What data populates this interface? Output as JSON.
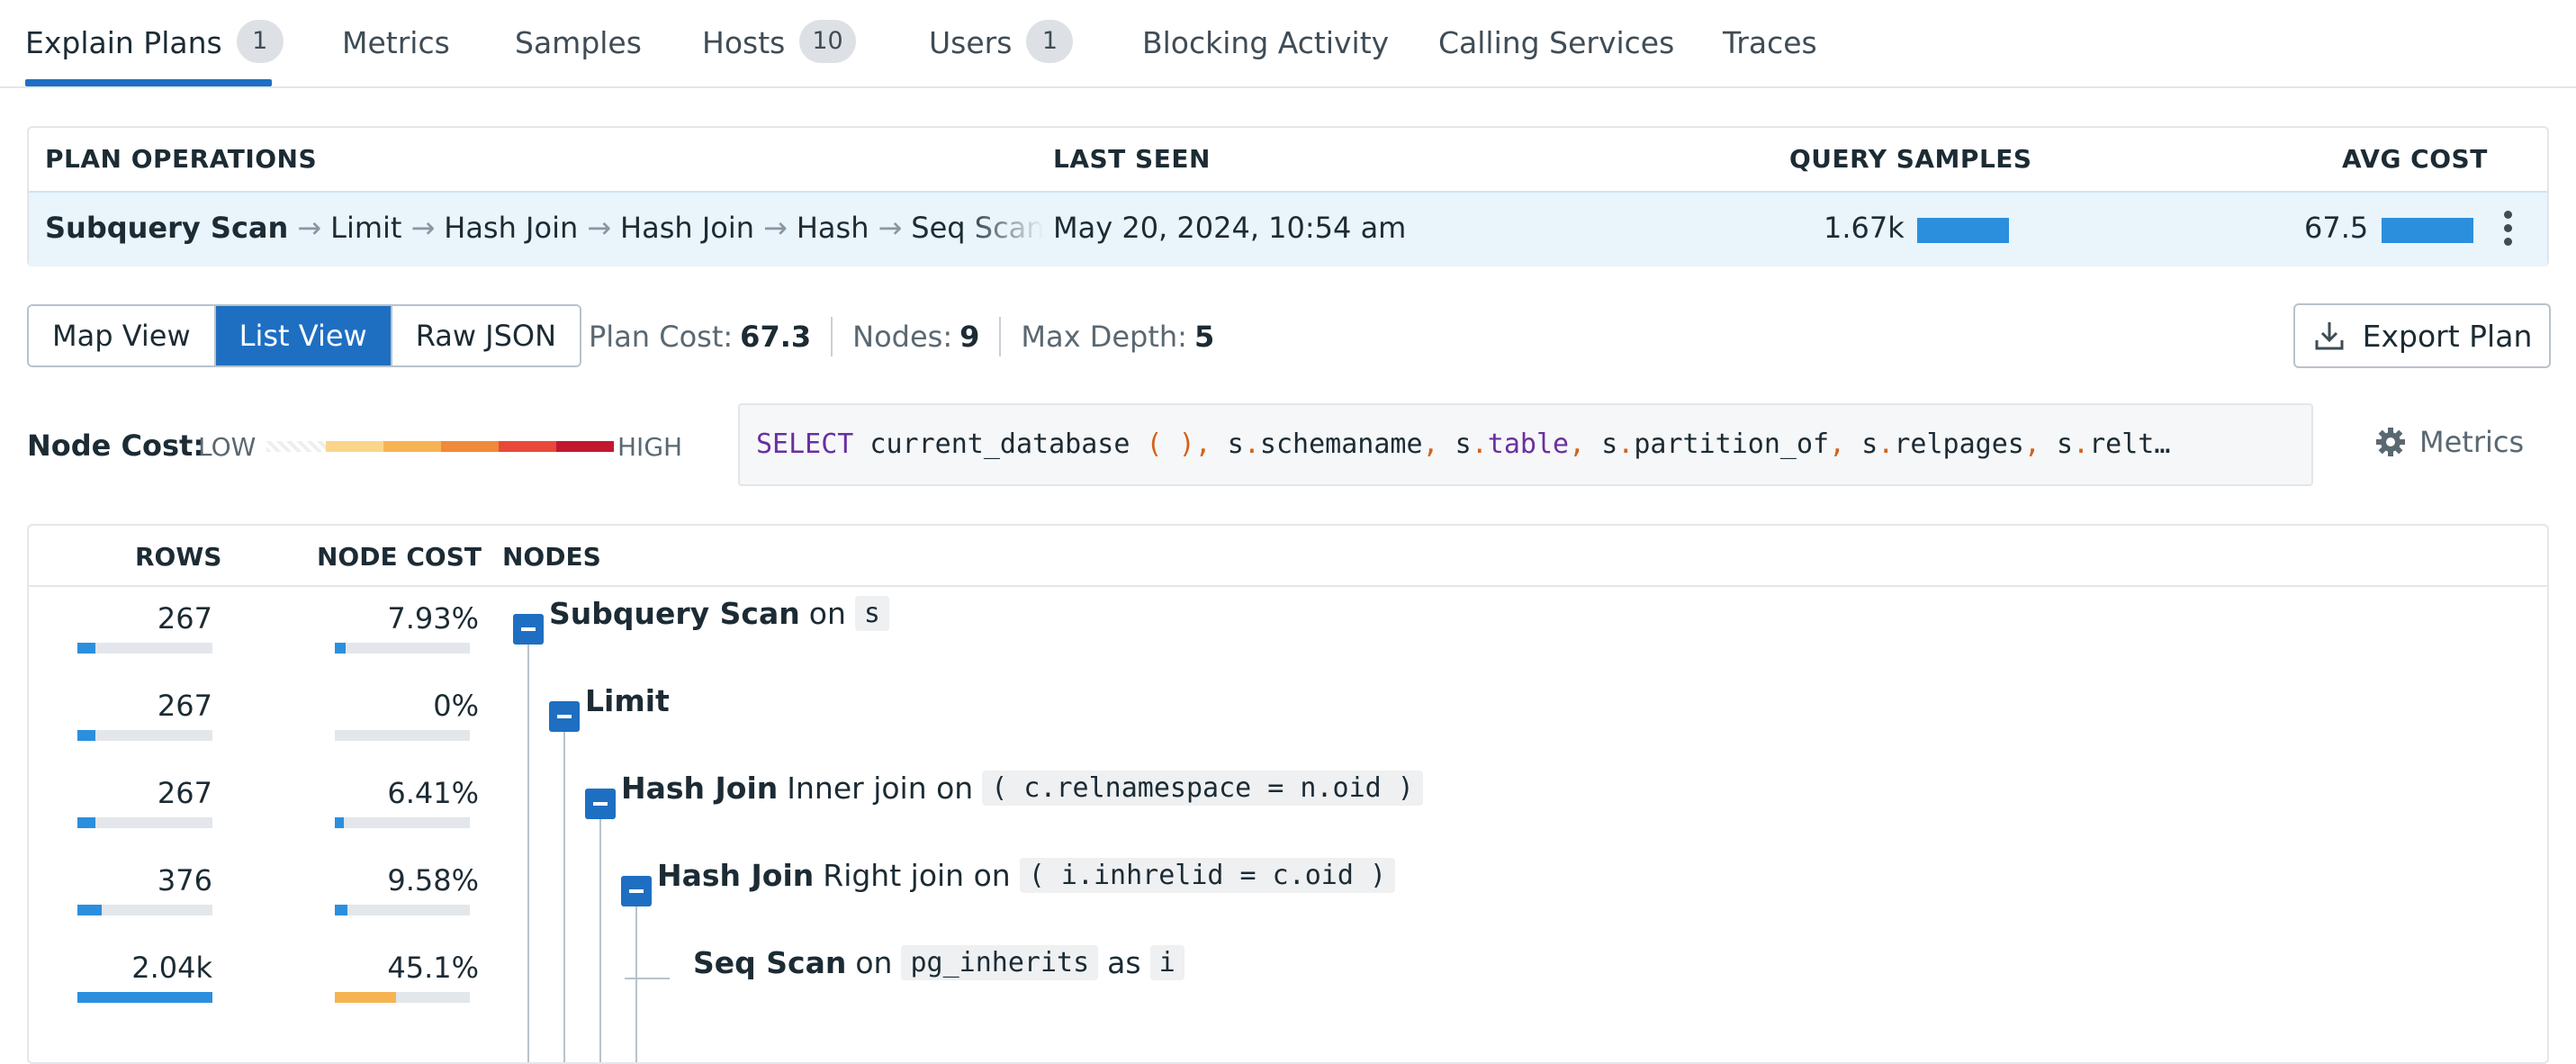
{
  "tabs": [
    {
      "label": "Explain Plans",
      "badge": "1"
    },
    {
      "label": "Metrics"
    },
    {
      "label": "Samples"
    },
    {
      "label": "Hosts",
      "badge": "10"
    },
    {
      "label": "Users",
      "badge": "1"
    },
    {
      "label": "Blocking Activity"
    },
    {
      "label": "Calling Services"
    },
    {
      "label": "Traces"
    }
  ],
  "plan_table": {
    "headers": {
      "operations": "PLAN OPERATIONS",
      "last_seen": "LAST SEEN",
      "query_samples": "QUERY SAMPLES",
      "avg_cost": "AVG COST"
    },
    "row": {
      "operations": [
        "Subquery Scan",
        "Limit",
        "Hash Join",
        "Hash Join",
        "Hash",
        "Seq Scan"
      ],
      "last_seen": "May 20, 2024, 10:54 am",
      "query_samples": "1.67k",
      "avg_cost": "67.5"
    }
  },
  "view_switch": {
    "map": "Map View",
    "list": "List View",
    "raw": "Raw JSON"
  },
  "stats": {
    "plan_cost_label": "Plan Cost:",
    "plan_cost": "67.3",
    "nodes_label": "Nodes:",
    "nodes": "9",
    "depth_label": "Max Depth:",
    "depth": "5"
  },
  "export_label": "Export Plan",
  "legend": {
    "label": "Node Cost:",
    "low": "LOW",
    "high": "HIGH"
  },
  "query": {
    "tokens": [
      {
        "t": "SELECT",
        "c": "kw"
      },
      {
        "t": " current_database ",
        "c": ""
      },
      {
        "t": "(",
        "c": "pn"
      },
      {
        "t": " ",
        "c": ""
      },
      {
        "t": ")",
        "c": "pn"
      },
      {
        "t": ",",
        "c": "pn"
      },
      {
        "t": " s",
        "c": ""
      },
      {
        "t": ".",
        "c": "pn"
      },
      {
        "t": "schemaname",
        "c": ""
      },
      {
        "t": ",",
        "c": "pn"
      },
      {
        "t": " s",
        "c": ""
      },
      {
        "t": ".",
        "c": "pn"
      },
      {
        "t": "table",
        "c": "kw"
      },
      {
        "t": ",",
        "c": "pn"
      },
      {
        "t": " s",
        "c": ""
      },
      {
        "t": ".",
        "c": "pn"
      },
      {
        "t": "partition_of",
        "c": ""
      },
      {
        "t": ",",
        "c": "pn"
      },
      {
        "t": " s",
        "c": ""
      },
      {
        "t": ".",
        "c": "pn"
      },
      {
        "t": "relpages",
        "c": ""
      },
      {
        "t": ",",
        "c": "pn"
      },
      {
        "t": " s",
        "c": ""
      },
      {
        "t": ".",
        "c": "pn"
      },
      {
        "t": "relt…",
        "c": ""
      }
    ]
  },
  "metrics_label": "Metrics",
  "nodes_table": {
    "headers": {
      "rows": "ROWS",
      "cost": "NODE COST",
      "nodes": "NODES"
    },
    "rows": [
      {
        "rows": "267",
        "rows_frac": 0.13,
        "cost": "7.93%",
        "cost_frac": 0.079,
        "cost_color": "#2b8fde",
        "depth": 0,
        "name": "Subquery Scan",
        "parts": [
          {
            "k": "txt",
            "v": "on"
          },
          {
            "k": "code",
            "v": "s"
          }
        ],
        "collapsible": true
      },
      {
        "rows": "267",
        "rows_frac": 0.13,
        "cost": "0%",
        "cost_frac": 0.0,
        "cost_color": "#2b8fde",
        "depth": 1,
        "name": "Limit",
        "parts": [],
        "collapsible": true
      },
      {
        "rows": "267",
        "rows_frac": 0.13,
        "cost": "6.41%",
        "cost_frac": 0.064,
        "cost_color": "#2b8fde",
        "depth": 2,
        "name": "Hash Join",
        "parts": [
          {
            "k": "txt",
            "v": "Inner join on"
          },
          {
            "k": "code",
            "v": "( c.relnamespace = n.oid )"
          }
        ],
        "collapsible": true
      },
      {
        "rows": "376",
        "rows_frac": 0.18,
        "cost": "9.58%",
        "cost_frac": 0.096,
        "cost_color": "#2b8fde",
        "depth": 3,
        "name": "Hash Join",
        "parts": [
          {
            "k": "txt",
            "v": "Right join on"
          },
          {
            "k": "code",
            "v": "( i.inhrelid = c.oid )"
          }
        ],
        "collapsible": true
      },
      {
        "rows": "2.04k",
        "rows_frac": 1.0,
        "cost": "45.1%",
        "cost_frac": 0.451,
        "cost_color": "#f6b352",
        "depth": 4,
        "name": "Seq Scan",
        "parts": [
          {
            "k": "txt",
            "v": "on"
          },
          {
            "k": "code",
            "v": "pg_inherits"
          },
          {
            "k": "txt",
            "v": "as"
          },
          {
            "k": "code",
            "v": "i"
          }
        ],
        "collapsible": false
      }
    ]
  },
  "colors": {
    "accent": "#1e6fc2",
    "bar": "#2b8fde",
    "high_cost": "#f6b352"
  }
}
